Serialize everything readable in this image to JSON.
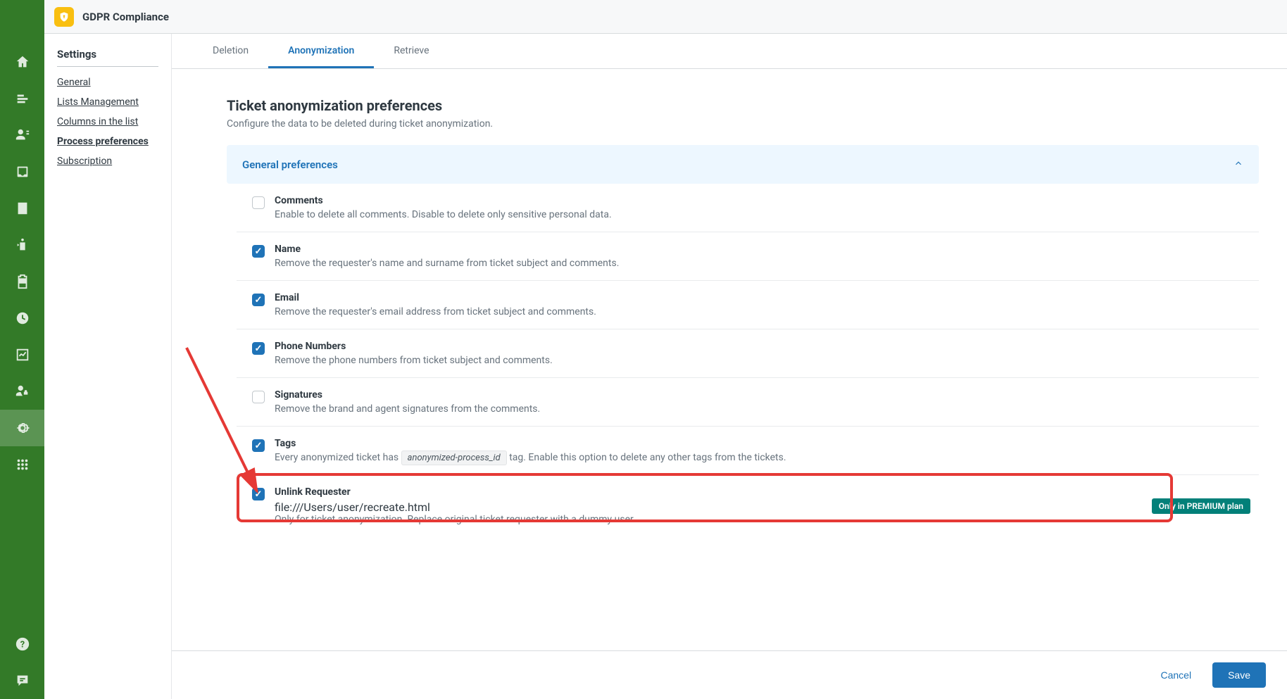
{
  "header": {
    "app_name": "GDPR Compliance"
  },
  "sidebar": {
    "heading": "Settings",
    "items": [
      {
        "label": "General"
      },
      {
        "label": "Lists Management"
      },
      {
        "label": "Columns in the list"
      },
      {
        "label": "Process preferences"
      },
      {
        "label": "Subscription"
      }
    ]
  },
  "tabs": [
    {
      "label": "Deletion"
    },
    {
      "label": "Anonymization"
    },
    {
      "label": "Retrieve"
    }
  ],
  "page": {
    "title": "Ticket anonymization preferences",
    "subtitle": "Configure the data to be deleted during ticket anonymization."
  },
  "accordion": {
    "title": "General preferences"
  },
  "prefs": [
    {
      "title": "Comments",
      "desc": "Enable to delete all comments. Disable to delete only sensitive personal data.",
      "checked": false
    },
    {
      "title": "Name",
      "desc": "Remove the requester's name and surname from ticket subject and comments.",
      "checked": true
    },
    {
      "title": "Email",
      "desc": "Remove the requester's email address from ticket subject and comments.",
      "checked": true
    },
    {
      "title": "Phone Numbers",
      "desc": "Remove the phone numbers from ticket subject and comments.",
      "checked": true
    },
    {
      "title": "Signatures",
      "desc": "Remove the brand and agent signatures from the comments.",
      "checked": false
    },
    {
      "title": "Tags",
      "desc_pre": "Every anonymized ticket has ",
      "code": "anonymized-process_id",
      "desc_post": " tag. Enable this option to delete any other tags from the tickets.",
      "checked": true
    },
    {
      "title": "Unlink Requester",
      "desc": "Only for ticket anonymization. Replace original ticket requester with a dummy user",
      "checked": true,
      "badge": "Only in PREMIUM plan"
    }
  ],
  "footer": {
    "cancel": "Cancel",
    "save": "Save"
  }
}
